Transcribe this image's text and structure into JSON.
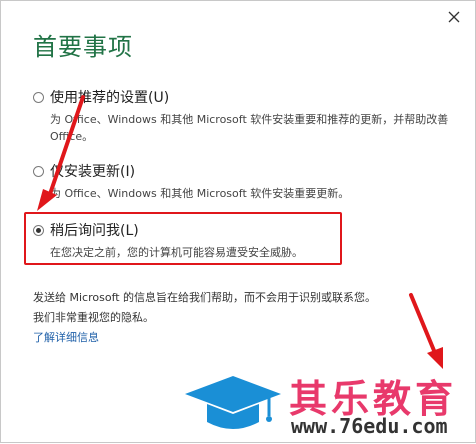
{
  "dialog": {
    "title": "首要事项",
    "close_icon": "close-icon"
  },
  "options": [
    {
      "label": "使用推荐的设置(U)",
      "description": "为 Office、Windows 和其他 Microsoft 软件安装重要和推荐的更新，并帮助改善 Office。",
      "selected": false
    },
    {
      "label": "仅安装更新(I)",
      "description": "为 Office、Windows 和其他 Microsoft 软件安装重要更新。",
      "selected": false
    },
    {
      "label": "稍后询问我(L)",
      "description": "在您决定之前，您的计算机可能容易遭受安全威胁。",
      "selected": true
    }
  ],
  "info": {
    "line1": "发送给 Microsoft 的信息旨在给我们帮助，而不会用于识别或联系您。",
    "line2": "我们非常重视您的隐私。"
  },
  "learn_more_link": "了解详细信息",
  "watermark": {
    "title": "其乐教育",
    "url": "www.76edu.com"
  },
  "colors": {
    "title_green": "#217346",
    "annotation_red": "#e0171b",
    "link_blue": "#1e5fa8",
    "watermark_pink": "#e8396b",
    "watermark_blue": "#1a8fd6"
  }
}
